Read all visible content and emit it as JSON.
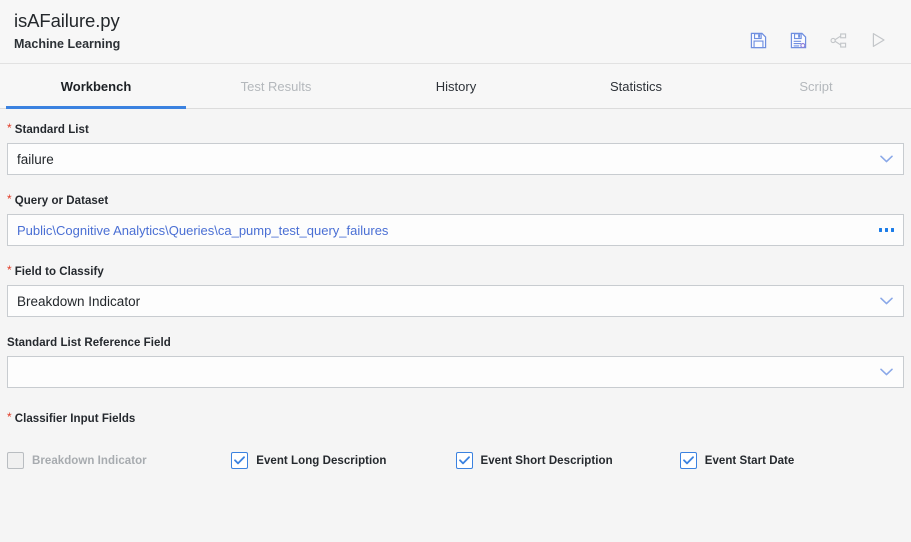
{
  "header": {
    "title": "isAFailure.py",
    "subtitle": "Machine Learning",
    "actions": [
      {
        "name": "save-icon",
        "label": "Save",
        "state": "enabled"
      },
      {
        "name": "save-as-icon",
        "label": "Save As",
        "state": "enabled"
      },
      {
        "name": "share-icon",
        "label": "Share",
        "state": "disabled"
      },
      {
        "name": "run-icon",
        "label": "Run",
        "state": "disabled"
      }
    ]
  },
  "tabs": [
    {
      "label": "Workbench",
      "state": "active"
    },
    {
      "label": "Test Results",
      "state": "disabled"
    },
    {
      "label": "History",
      "state": "enabled"
    },
    {
      "label": "Statistics",
      "state": "enabled"
    },
    {
      "label": "Script",
      "state": "disabled"
    }
  ],
  "form": {
    "standard_list": {
      "label": "Standard List",
      "required": true,
      "value": "failure",
      "control": "dropdown"
    },
    "query_or_dataset": {
      "label": "Query or Dataset",
      "required": true,
      "value": "Public\\Cognitive Analytics\\Queries\\ca_pump_test_query_failures",
      "control": "browse"
    },
    "field_to_classify": {
      "label": "Field to Classify",
      "required": true,
      "value": "Breakdown Indicator",
      "control": "dropdown"
    },
    "standard_list_reference_field": {
      "label": "Standard List Reference Field",
      "required": false,
      "value": "",
      "control": "dropdown"
    },
    "classifier_input_fields": {
      "label": "Classifier Input Fields",
      "required": true,
      "options": [
        {
          "label": "Breakdown Indicator",
          "checked": false,
          "disabled": true
        },
        {
          "label": "Event Long Description",
          "checked": true,
          "disabled": false
        },
        {
          "label": "Event Short Description",
          "checked": true,
          "disabled": false
        },
        {
          "label": "Event Start Date",
          "checked": true,
          "disabled": false
        }
      ]
    }
  },
  "colors": {
    "accent": "#3b82e0",
    "required": "#e03b26",
    "link": "#4a6fd4",
    "page_bg": "#f5f5f5",
    "header_bg": "#f7f7f7"
  }
}
